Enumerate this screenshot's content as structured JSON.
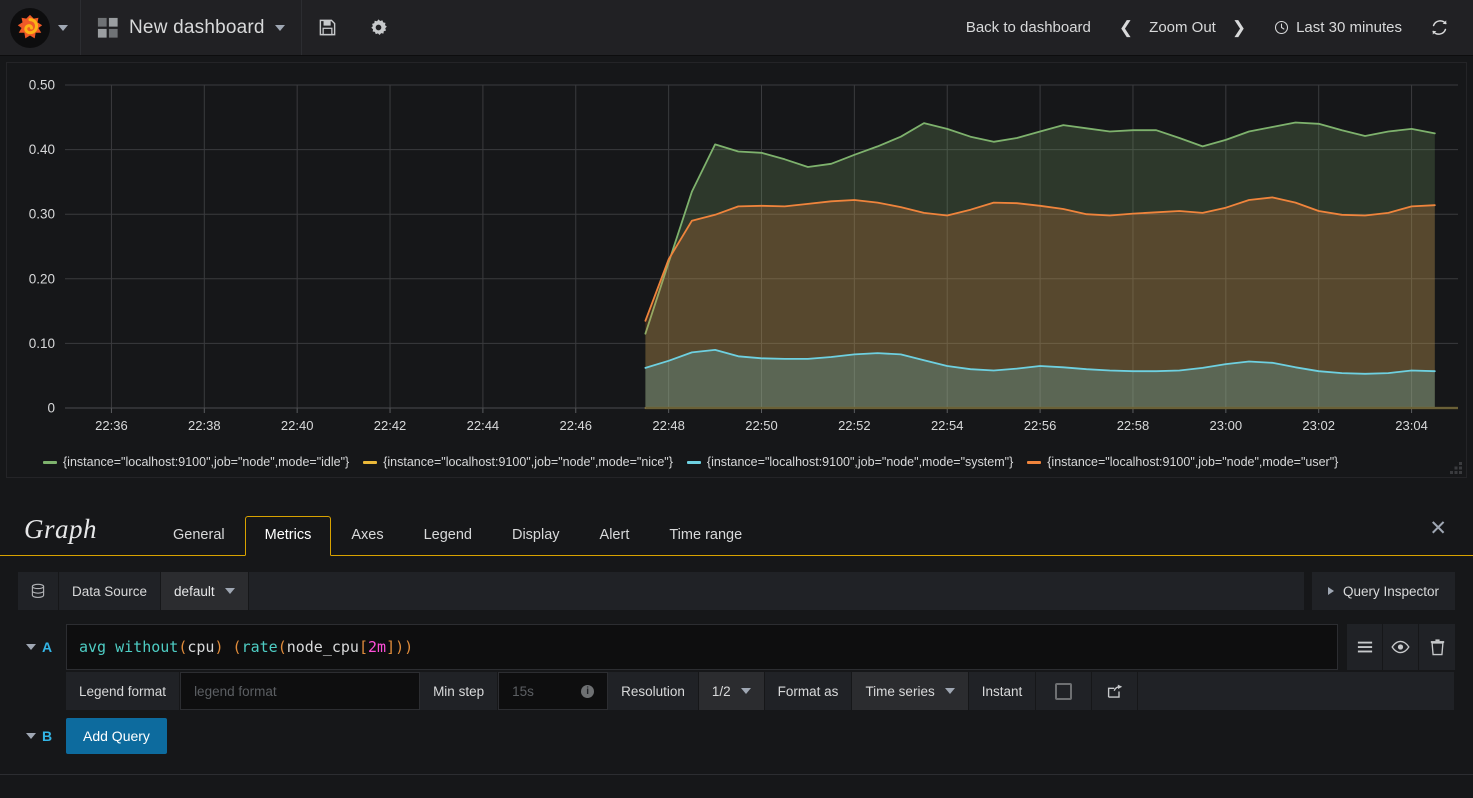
{
  "navbar": {
    "logo_icon": "grafana-logo-icon",
    "logo_caret_icon": "chevron-down-icon",
    "dashboard_icon": "dashboard-grid-icon",
    "dashboard_title": "New dashboard",
    "dashboard_caret_icon": "chevron-down-icon",
    "save_icon": "floppy-save-icon",
    "settings_icon": "gear-icon",
    "back_to_dashboard": "Back to dashboard",
    "zoom_prev_icon": "chevron-left-icon",
    "zoom_out_label": "Zoom Out",
    "zoom_next_icon": "chevron-right-icon",
    "clock_icon": "clock-icon",
    "time_range": "Last 30 minutes",
    "refresh_icon": "refresh-icon"
  },
  "chart_data": {
    "type": "area",
    "title": "",
    "xlabel": "",
    "ylabel": "",
    "stacked": false,
    "grid": true,
    "legend_position": "bottom",
    "ylim": [
      0,
      0.5
    ],
    "ytick_labels": [
      "0.50",
      "0.40",
      "0.30",
      "0.20",
      "0.10",
      "0"
    ],
    "ytick_values": [
      0.5,
      0.4,
      0.3,
      0.2,
      0.1,
      0
    ],
    "xtick_labels": [
      "22:36",
      "22:38",
      "22:40",
      "22:42",
      "22:44",
      "22:46",
      "22:48",
      "22:50",
      "22:52",
      "22:54",
      "22:56",
      "22:58",
      "23:00",
      "23:02",
      "23:04"
    ],
    "x_start": "22:35",
    "x_end": "23:05",
    "data_start": "22:47:30",
    "series": [
      {
        "name": "{instance=\"localhost:9100\",job=\"node\",mode=\"idle\"}",
        "color": "#7eb26d",
        "x": [
          "22:47.5",
          "22:48",
          "22:48.5",
          "22:49",
          "22:49.5",
          "22:50",
          "22:50.5",
          "22:51",
          "22:51.5",
          "22:52",
          "22:52.5",
          "22:53",
          "22:53.5",
          "22:54",
          "22:54.5",
          "22:55",
          "22:55.5",
          "22:56",
          "22:56.5",
          "22:57",
          "22:57.5",
          "22:58",
          "22:58.5",
          "22:59",
          "22:59.5",
          "23:00",
          "23:00.5",
          "23:01",
          "23:01.5",
          "23:02",
          "23:02.5",
          "23:03",
          "23:03.5",
          "23:04",
          "23:04.5"
        ],
        "values": [
          0.115,
          0.225,
          0.335,
          0.408,
          0.397,
          0.395,
          0.385,
          0.373,
          0.378,
          0.392,
          0.405,
          0.42,
          0.441,
          0.432,
          0.42,
          0.412,
          0.418,
          0.428,
          0.438,
          0.433,
          0.428,
          0.43,
          0.43,
          0.418,
          0.405,
          0.415,
          0.428,
          0.435,
          0.442,
          0.44,
          0.43,
          0.421,
          0.428,
          0.432,
          0.425
        ]
      },
      {
        "name": "{instance=\"localhost:9100\",job=\"node\",mode=\"nice\"}",
        "color": "#eab839",
        "x": [
          "22:47.5",
          "23:04.5"
        ],
        "values": [
          0,
          0
        ]
      },
      {
        "name": "{instance=\"localhost:9100\",job=\"node\",mode=\"system\"}",
        "color": "#6ed0e0",
        "x": [
          "22:47.5",
          "22:48",
          "22:48.5",
          "22:49",
          "22:49.5",
          "22:50",
          "22:50.5",
          "22:51",
          "22:51.5",
          "22:52",
          "22:52.5",
          "22:53",
          "22:53.5",
          "22:54",
          "22:54.5",
          "22:55",
          "22:55.5",
          "22:56",
          "22:56.5",
          "22:57",
          "22:57.5",
          "22:58",
          "22:58.5",
          "22:59",
          "22:59.5",
          "23:00",
          "23:00.5",
          "23:01",
          "23:01.5",
          "23:02",
          "23:02.5",
          "23:03",
          "23:03.5",
          "23:04",
          "23:04.5"
        ],
        "values": [
          0.062,
          0.073,
          0.086,
          0.09,
          0.08,
          0.077,
          0.076,
          0.076,
          0.079,
          0.083,
          0.085,
          0.083,
          0.074,
          0.065,
          0.06,
          0.058,
          0.061,
          0.065,
          0.063,
          0.06,
          0.058,
          0.057,
          0.057,
          0.058,
          0.062,
          0.068,
          0.072,
          0.07,
          0.063,
          0.057,
          0.054,
          0.053,
          0.054,
          0.058,
          0.057
        ]
      },
      {
        "name": "{instance=\"localhost:9100\",job=\"node\",mode=\"user\"}",
        "color": "#ef843c",
        "x": [
          "22:47.5",
          "22:48",
          "22:48.5",
          "22:49",
          "22:49.5",
          "22:50",
          "22:50.5",
          "22:51",
          "22:51.5",
          "22:52",
          "22:52.5",
          "22:53",
          "22:53.5",
          "22:54",
          "22:54.5",
          "22:55",
          "22:55.5",
          "22:56",
          "22:56.5",
          "22:57",
          "22:57.5",
          "22:58",
          "22:58.5",
          "22:59",
          "22:59.5",
          "23:00",
          "23:00.5",
          "23:01",
          "23:01.5",
          "23:02",
          "23:02.5",
          "23:03",
          "23:03.5",
          "23:04",
          "23:04.5"
        ],
        "values": [
          0.135,
          0.23,
          0.29,
          0.299,
          0.312,
          0.313,
          0.312,
          0.316,
          0.32,
          0.322,
          0.318,
          0.311,
          0.302,
          0.298,
          0.307,
          0.318,
          0.317,
          0.313,
          0.308,
          0.3,
          0.298,
          0.301,
          0.303,
          0.305,
          0.302,
          0.31,
          0.322,
          0.326,
          0.318,
          0.305,
          0.299,
          0.298,
          0.302,
          0.312,
          0.314
        ]
      }
    ]
  },
  "editor": {
    "panel_type": "Graph",
    "tabs": [
      {
        "label": "General",
        "active": false
      },
      {
        "label": "Metrics",
        "active": true
      },
      {
        "label": "Axes",
        "active": false
      },
      {
        "label": "Legend",
        "active": false
      },
      {
        "label": "Display",
        "active": false
      },
      {
        "label": "Alert",
        "active": false
      },
      {
        "label": "Time range",
        "active": false
      }
    ],
    "close_icon": "close-icon",
    "datasource": {
      "db_icon": "database-icon",
      "label": "Data Source",
      "value": "default",
      "caret_icon": "chevron-down-icon"
    },
    "query_inspector": {
      "label": "Query Inspector",
      "expand_icon": "triangle-right-icon"
    },
    "queries": [
      {
        "letter": "A",
        "collapse_icon": "chevron-down-icon",
        "expression_tokens": [
          {
            "text": "avg",
            "type": "fn"
          },
          {
            "text": " ",
            "type": "plain"
          },
          {
            "text": "without",
            "type": "fn"
          },
          {
            "text": "(",
            "type": "paren"
          },
          {
            "text": "cpu",
            "type": "id"
          },
          {
            "text": ")",
            "type": "paren"
          },
          {
            "text": " ",
            "type": "plain"
          },
          {
            "text": "(",
            "type": "paren"
          },
          {
            "text": "rate",
            "type": "fn"
          },
          {
            "text": "(",
            "type": "paren"
          },
          {
            "text": "node_cpu",
            "type": "id"
          },
          {
            "text": "[",
            "type": "bracket"
          },
          {
            "text": "2m",
            "type": "dur"
          },
          {
            "text": "]",
            "type": "bracket"
          },
          {
            "text": ")",
            "type": "paren"
          },
          {
            "text": ")",
            "type": "paren"
          }
        ],
        "expression_text": "avg without(cpu) (rate(node_cpu[2m]))",
        "actions": [
          {
            "icon": "hamburger-menu-icon",
            "name": "query-options-button"
          },
          {
            "icon": "eye-icon",
            "name": "toggle-query-visibility-button"
          },
          {
            "icon": "trash-icon",
            "name": "remove-query-button"
          }
        ],
        "options": {
          "legend_format_label": "Legend format",
          "legend_format_placeholder": "legend format",
          "legend_format_value": "",
          "min_step_label": "Min step",
          "min_step_placeholder": "15s",
          "min_step_value": "",
          "min_step_info_icon": "info-icon",
          "resolution_label": "Resolution",
          "resolution_value": "1/2",
          "resolution_caret_icon": "chevron-down-icon",
          "format_as_label": "Format as",
          "format_as_value": "Time series",
          "format_as_caret_icon": "chevron-down-icon",
          "instant_label": "Instant",
          "instant_checked": false,
          "share_icon": "external-link-icon"
        }
      }
    ],
    "add_query": {
      "letter": "B",
      "collapse_icon": "chevron-down-icon",
      "label": "Add Query"
    }
  },
  "colors": {
    "accent_orange": "#d8a200",
    "link_blue": "#33b5e5",
    "button_blue": "#0d6b9e",
    "panel_bg": "#161719",
    "navbar_bg": "#212124",
    "segment_bg": "#202226"
  }
}
